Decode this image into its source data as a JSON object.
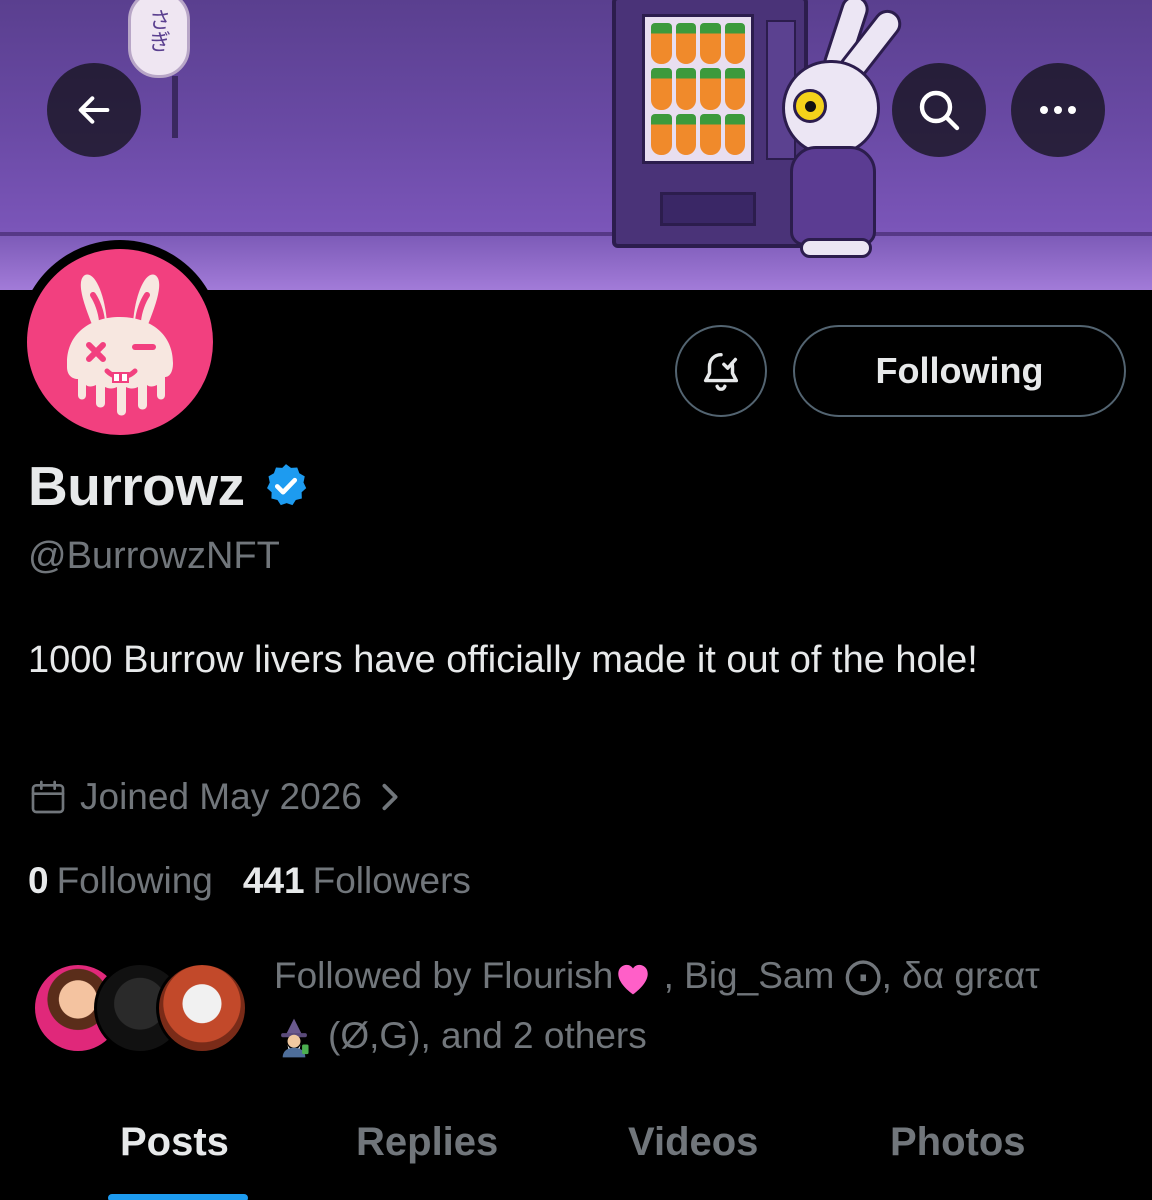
{
  "banner": {
    "lantern_text": "さぎ",
    "back_icon": "arrow-left-icon",
    "search_icon": "search-icon",
    "more_icon": "more-horizontal-icon"
  },
  "profile": {
    "display_name": "Burrowz",
    "verified": true,
    "handle": "@BurrowzNFT",
    "bio": "1000 Burrow livers have officially made it out of the hole!",
    "joined": "Joined May 2026",
    "avatar_color": "#f2407f"
  },
  "actions": {
    "notifications_icon": "bell-check-icon",
    "following_label": "Following"
  },
  "stats": {
    "following_count": "0",
    "following_label": "Following",
    "followers_count": "441",
    "followers_label": "Followers"
  },
  "followed_by": {
    "line1_prefix": "Followed by Flourish",
    "line1_suffix": " , Big_Sam ⨀, δα grεατ",
    "line2": "(Ø,G), and 2 others"
  },
  "tabs": [
    {
      "label": "Posts",
      "active": true
    },
    {
      "label": "Replies",
      "active": false
    },
    {
      "label": "Videos",
      "active": false
    },
    {
      "label": "Photos",
      "active": false
    }
  ],
  "colors": {
    "background": "#000000",
    "primary_text": "#e7e9ea",
    "secondary_text": "#71767b",
    "accent": "#1d9bf0",
    "border": "#536471"
  }
}
